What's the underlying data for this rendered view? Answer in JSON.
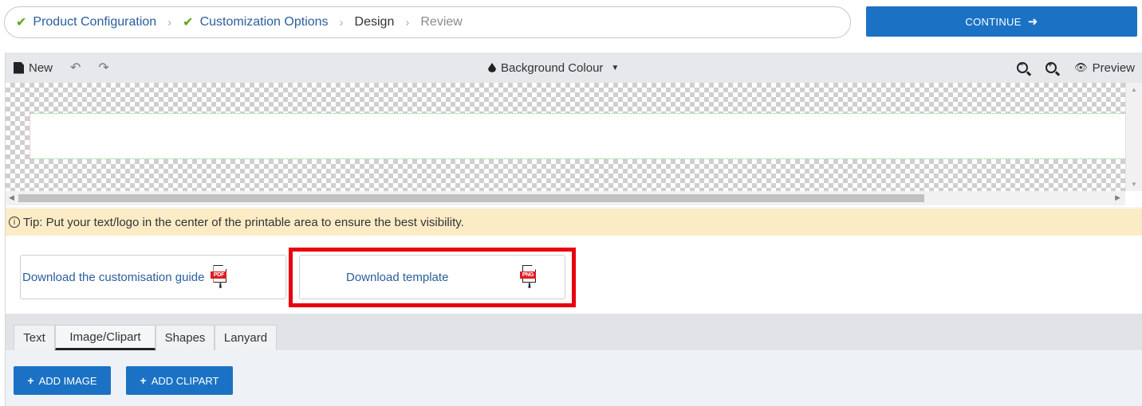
{
  "stepper": {
    "steps": [
      {
        "label": "Product Configuration",
        "state": "done"
      },
      {
        "label": "Customization Options",
        "state": "done"
      },
      {
        "label": "Design",
        "state": "current"
      },
      {
        "label": "Review",
        "state": "todo"
      }
    ],
    "separator": "›",
    "check_glyph": "✔"
  },
  "continue_button": {
    "label": "CONTINUE",
    "arrow": "➜"
  },
  "toolbar": {
    "new_label": "New",
    "undo_glyph": "↶",
    "redo_glyph": "↷",
    "background_label": "Background Colour",
    "caret": "▼",
    "preview_label": "Preview",
    "eye_glyph": "👁"
  },
  "tip": {
    "icon": "ⓘ",
    "text": "Tip: Put your text/logo in the center of the printable area to ensure the best visibility."
  },
  "downloads": {
    "guide_label": "Download the customisation guide",
    "guide_tag": "PDF",
    "template_label": "Download template",
    "template_tag": "PNG"
  },
  "tabs": [
    {
      "label": "Text"
    },
    {
      "label": "Image/Clipart",
      "active": true
    },
    {
      "label": "Shapes"
    },
    {
      "label": "Lanyard"
    }
  ],
  "actions": {
    "add_image_label": "ADD IMAGE",
    "add_clipart_label": "ADD CLIPART",
    "plus": "+"
  },
  "colors": {
    "primary": "#1b72c4",
    "check": "#5aa51e",
    "link": "#2a5e9c",
    "tip_bg": "#fcecc6",
    "highlight": "#e8000b"
  }
}
